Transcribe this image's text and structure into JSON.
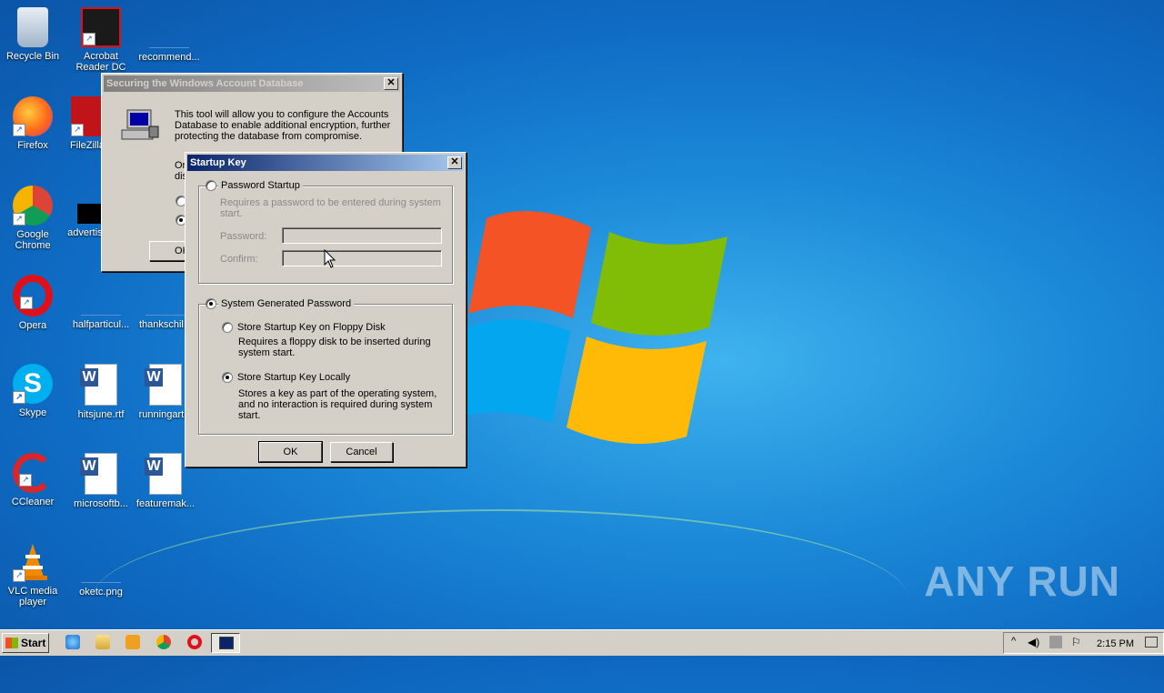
{
  "desktop": {
    "icons": [
      {
        "label": "Recycle Bin"
      },
      {
        "label": "Acrobat Reader DC"
      },
      {
        "label": "recommend..."
      },
      {
        "label": "Firefox"
      },
      {
        "label": "FileZilla"
      },
      {
        "label": "Google Chrome"
      },
      {
        "label": "advertis..."
      },
      {
        "label": "Opera"
      },
      {
        "label": "halfparticul..."
      },
      {
        "label": "thankschil..."
      },
      {
        "label": "Skype"
      },
      {
        "label": "hitsjune.rtf"
      },
      {
        "label": "runningart..."
      },
      {
        "label": "CCleaner"
      },
      {
        "label": "microsoftb..."
      },
      {
        "label": "featuremak..."
      },
      {
        "label": "VLC media player"
      },
      {
        "label": "oketc.png"
      }
    ]
  },
  "syskey_dialog": {
    "title": "Securing the Windows Account Database",
    "description": "This tool will allow you to configure the Accounts Database to enable additional encryption, further protecting the database from compromise.",
    "partial_line1": "Or",
    "partial_line2": "dis",
    "ok_label": "OK"
  },
  "startup_dialog": {
    "title": "Startup Key",
    "password_startup": {
      "label": "Password Startup",
      "desc": "Requires a password to be entered during system start.",
      "password_label": "Password:",
      "confirm_label": "Confirm:",
      "password_value": "",
      "confirm_value": ""
    },
    "system_generated": {
      "label": "System Generated Password",
      "floppy_label": "Store Startup Key on Floppy Disk",
      "floppy_desc": "Requires a floppy disk to be inserted during system start.",
      "local_label": "Store Startup Key Locally",
      "local_desc": "Stores a key as part of the operating system, and no interaction is required during system start."
    },
    "ok_label": "OK",
    "cancel_label": "Cancel"
  },
  "taskbar": {
    "start_label": "Start",
    "clock": "2:15 PM"
  },
  "watermark": "ANY RUN"
}
